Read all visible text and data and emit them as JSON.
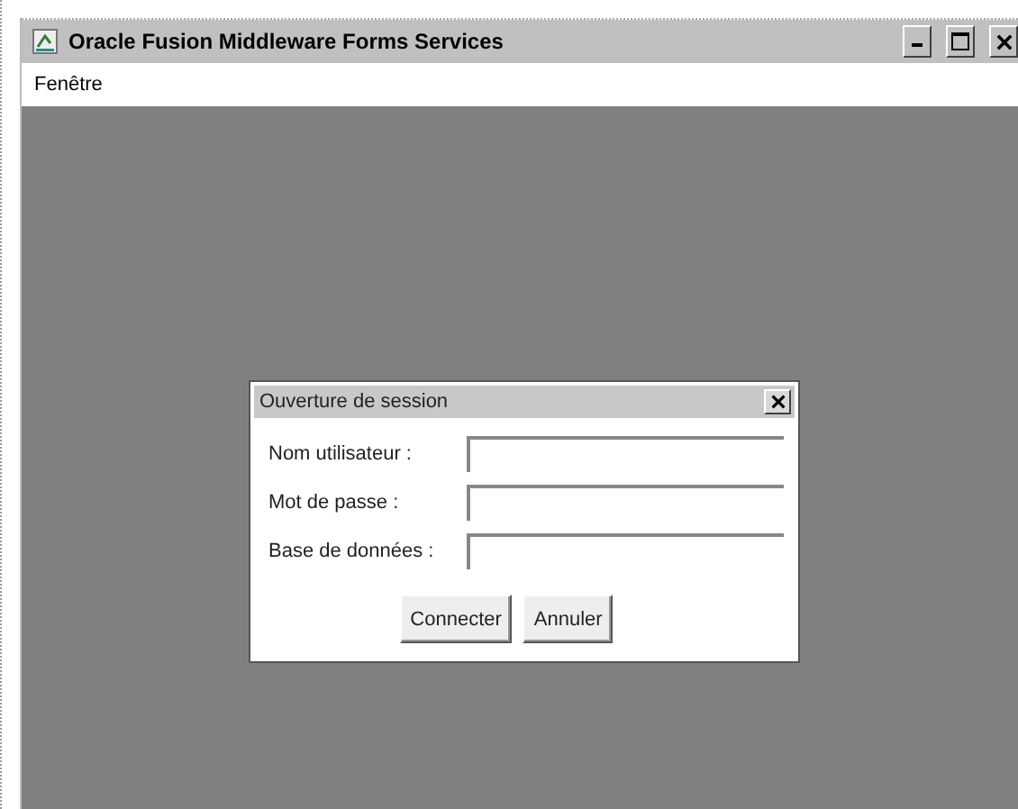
{
  "window": {
    "title": "Oracle Fusion Middleware Forms Services"
  },
  "menu": [
    "Fenêtre"
  ],
  "dialog": {
    "title": "Ouverture de session",
    "fields": [
      {
        "label": "Nom utilisateur :"
      },
      {
        "label": "Mot de passe :"
      },
      {
        "label": "Base de données :"
      }
    ],
    "buttons": [
      "Connecter",
      "Annuler"
    ]
  }
}
